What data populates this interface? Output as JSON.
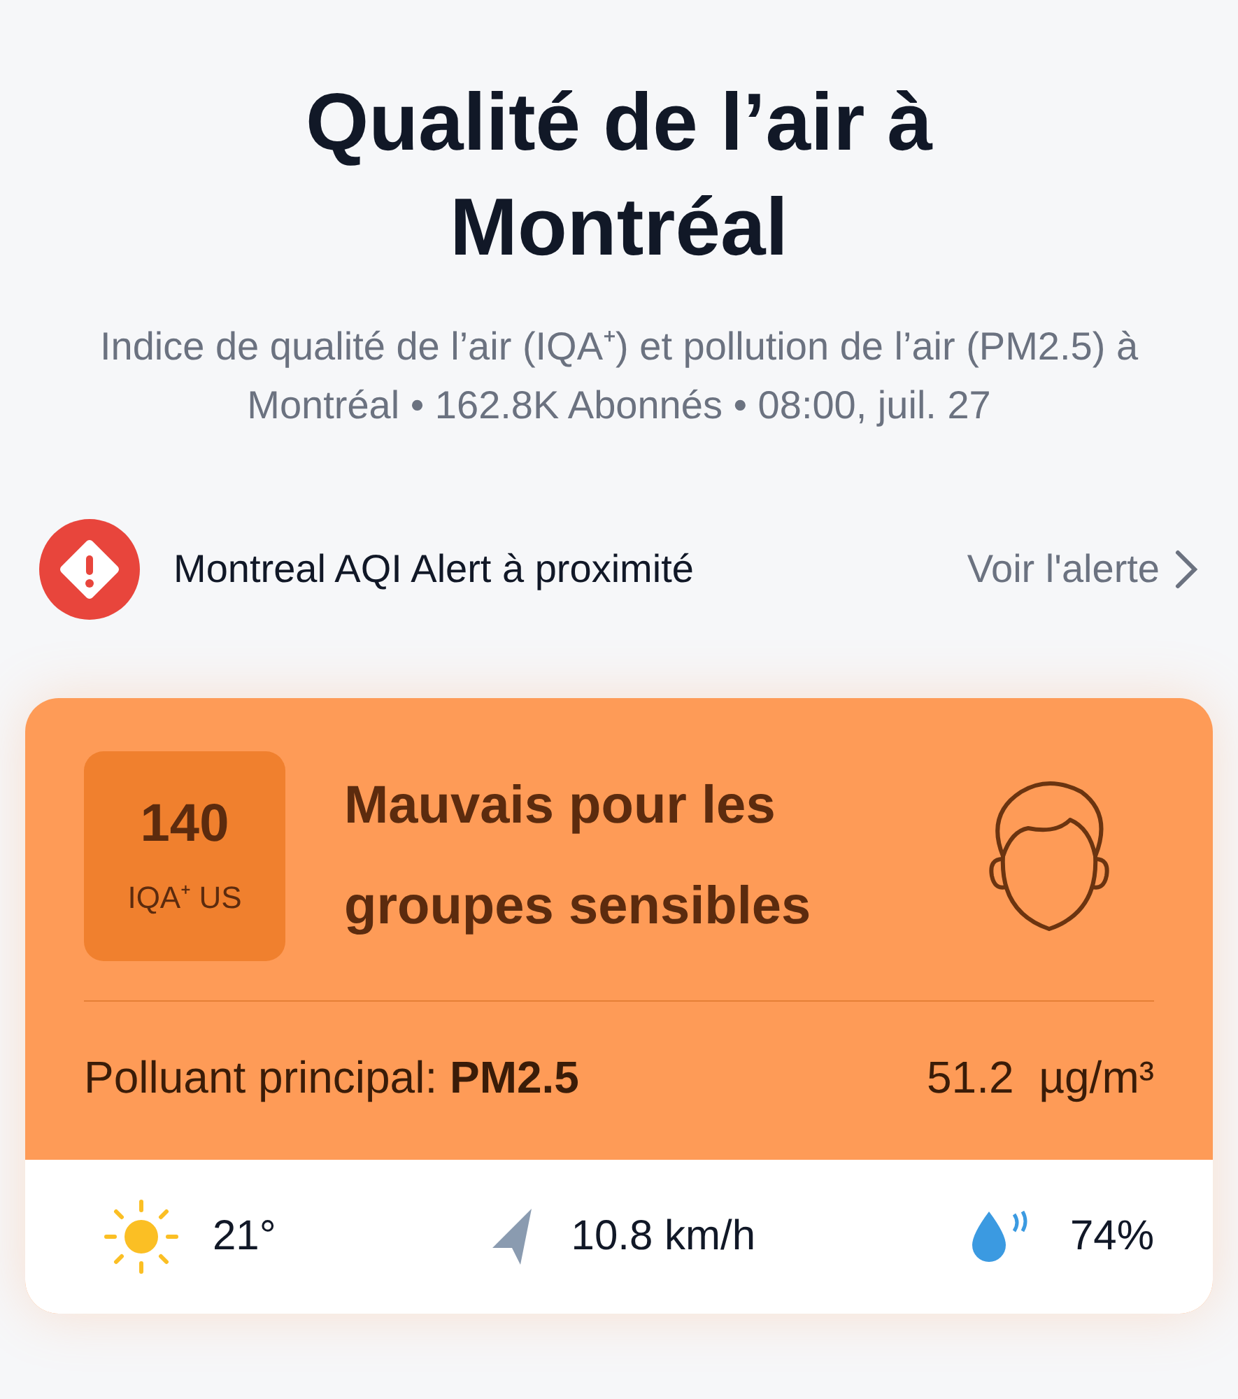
{
  "title": "Qualité de l’air à Montréal",
  "subtitle": "Indice de qualité de l’air (IQA⁺) et pollution de l’air (PM2.5) à Montréal • 162.8K Abonnés • 08:00, juil. 27",
  "alert": {
    "text": "Montreal AQI Alert à proximité",
    "link": "Voir l'alerte"
  },
  "aqi": {
    "value": "140",
    "unit": "IQA⁺ US",
    "status": "Mauvais pour les groupes sensibles",
    "pollutant": "Polluant principal: **PM2.5**",
    "concentration": "51.2  µg/m³"
  },
  "weather": {
    "temperature": "21°",
    "wind": "10.8 km/h",
    "humidity": "74%"
  }
}
